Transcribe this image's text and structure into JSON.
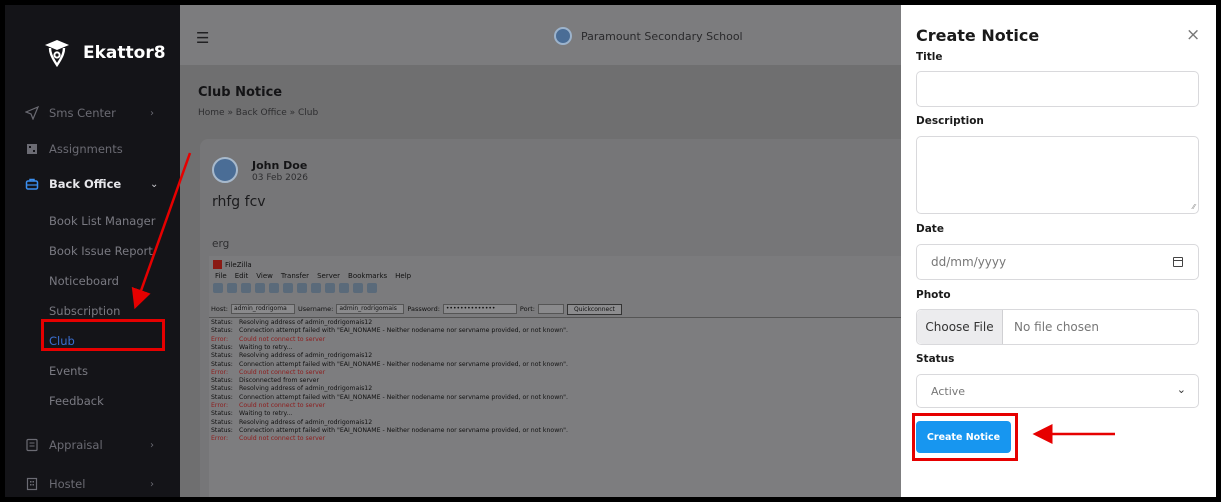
{
  "brand": {
    "name": "Ekattor8"
  },
  "sidebar": {
    "items": [
      {
        "label": "Sms Center",
        "icon": "send-icon",
        "chevron": "›"
      },
      {
        "label": "Assignments",
        "icon": "assignment-icon"
      },
      {
        "label": "Back Office",
        "icon": "briefcase-icon",
        "chevron": "⌄"
      },
      {
        "label": "Appraisal",
        "icon": "clipboard-icon",
        "chevron": "›"
      },
      {
        "label": "Hostel",
        "icon": "building-icon",
        "chevron": "›"
      }
    ],
    "sub_items": [
      "Book List Manager",
      "Book Issue Report",
      "Noticeboard",
      "Subscription",
      "Club",
      "Events",
      "Feedback"
    ]
  },
  "topbar": {
    "school_name": "Paramount Secondary School",
    "menu_icon": "menu-icon"
  },
  "page": {
    "title": "Club Notice",
    "breadcrumb": "Home » Back Office » Club"
  },
  "post": {
    "author": "John Doe",
    "date": "03 Feb 2026",
    "title": "rhfg fcv",
    "description": "erg"
  },
  "filezilla": {
    "title": "FileZilla",
    "menu": [
      "File",
      "Edit",
      "View",
      "Transfer",
      "Server",
      "Bookmarks",
      "Help"
    ],
    "host_label": "Host:",
    "host_value": "admin_rodrigoma",
    "username_label": "Username:",
    "username_value": "admin_rodrigomais",
    "password_label": "Password:",
    "password_value": "••••••••••••••",
    "port_label": "Port:",
    "quickconnect": "Quickconnect",
    "log": [
      {
        "status": "Status:",
        "text": "Resolving address of admin_rodrigomais12",
        "error": false
      },
      {
        "status": "Status:",
        "text": "Connection attempt failed with \"EAI_NONAME - Neither nodename nor servname provided, or not known\".",
        "error": false
      },
      {
        "status": "Error:",
        "text": "Could not connect to server",
        "error": true
      },
      {
        "status": "Status:",
        "text": "Waiting to retry...",
        "error": false
      },
      {
        "status": "Status:",
        "text": "Resolving address of admin_rodrigomais12",
        "error": false
      },
      {
        "status": "Status:",
        "text": "Connection attempt failed with \"EAI_NONAME - Neither nodename nor servname provided, or not known\".",
        "error": false
      },
      {
        "status": "Error:",
        "text": "Could not connect to server",
        "error": true
      },
      {
        "status": "Status:",
        "text": "Disconnected from server",
        "error": false
      },
      {
        "status": "Status:",
        "text": "Resolving address of admin_rodrigomais12",
        "error": false
      },
      {
        "status": "Status:",
        "text": "Connection attempt failed with \"EAI_NONAME - Neither nodename nor servname provided, or not known\".",
        "error": false
      },
      {
        "status": "Error:",
        "text": "Could not connect to server",
        "error": true
      },
      {
        "status": "Status:",
        "text": "Waiting to retry...",
        "error": false
      },
      {
        "status": "Status:",
        "text": "Resolving address of admin_rodrigomais12",
        "error": false
      },
      {
        "status": "Status:",
        "text": "Connection attempt failed with \"EAI_NONAME - Neither nodename nor servname provided, or not known\".",
        "error": false
      },
      {
        "status": "Error:",
        "text": "Could not connect to server",
        "error": true
      }
    ]
  },
  "panel": {
    "title": "Create Notice",
    "close": "×",
    "title_label": "Title",
    "description_label": "Description",
    "date_label": "Date",
    "date_placeholder": "dd/mm/yyyy",
    "photo_label": "Photo",
    "choose_file": "Choose File",
    "no_file": "No file chosen",
    "status_label": "Status",
    "status_value": "Active",
    "submit": "Create Notice"
  },
  "colors": {
    "accent": "#1796f0",
    "annotation": "#e60000",
    "sidebar_bg": "#141418"
  }
}
